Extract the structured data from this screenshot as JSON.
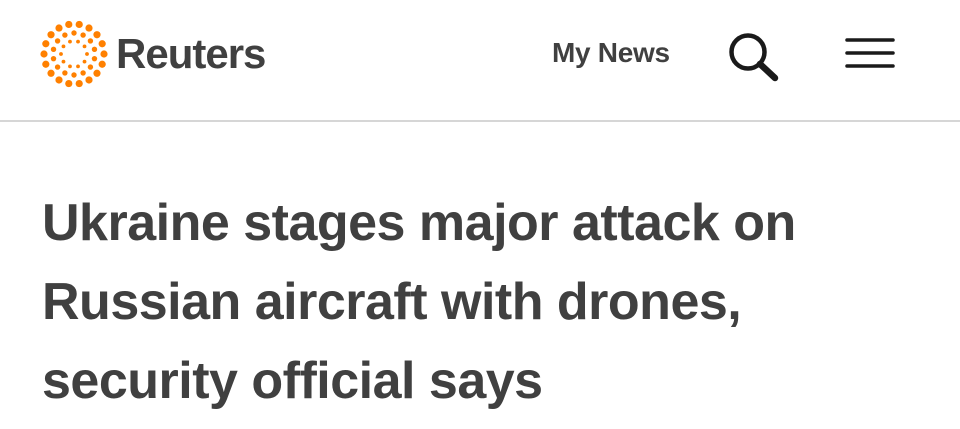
{
  "header": {
    "logo_text": "Reuters",
    "logo_icon": "reuters-dot-ring-logo",
    "my_news_label": "My News",
    "search_icon": "search-icon",
    "menu_icon": "hamburger-menu-icon",
    "brand_color": "#ff8000",
    "text_color": "#404040"
  },
  "article": {
    "headline_lines": [
      "Ukraine stages major attack on",
      "Russian aircraft with drones,",
      "security official says"
    ]
  }
}
